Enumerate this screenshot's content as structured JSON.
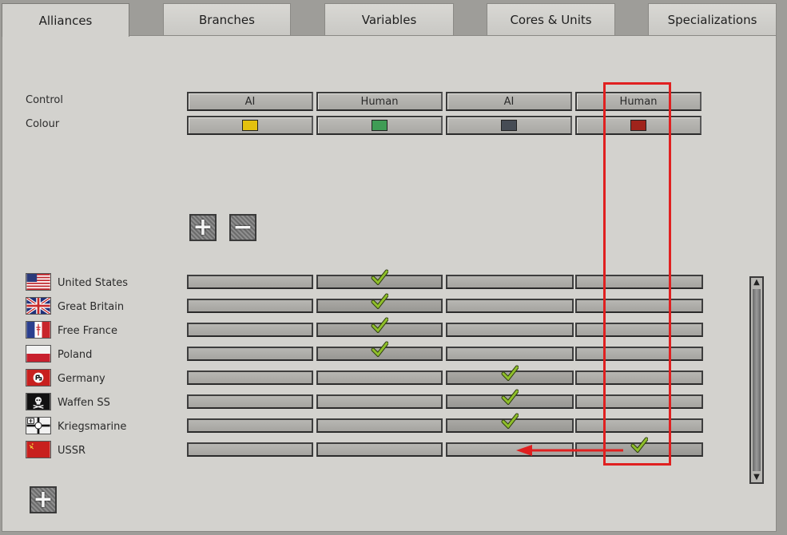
{
  "tabs": [
    {
      "label": "Alliances",
      "active": true
    },
    {
      "label": "Branches",
      "active": false
    },
    {
      "label": "Variables",
      "active": false
    },
    {
      "label": "Cores & Units",
      "active": false
    },
    {
      "label": "Specializations",
      "active": false
    }
  ],
  "settings": {
    "control_label": "Control",
    "colour_label": "Colour",
    "alliances": [
      {
        "control": "AI",
        "colour": "#e3c10f"
      },
      {
        "control": "Human",
        "colour": "#3f9c55"
      },
      {
        "control": "AI",
        "colour": "#464c55"
      },
      {
        "control": "Human",
        "colour": "#a0231b"
      }
    ]
  },
  "alliance_buttons": {
    "add": "+",
    "remove": "−"
  },
  "nations": [
    {
      "name": "United States",
      "flag": "usa-flag",
      "alliance": 2
    },
    {
      "name": "Great Britain",
      "flag": "gb-flag",
      "alliance": 2
    },
    {
      "name": "Free France",
      "flag": "free-france-flag",
      "alliance": 2
    },
    {
      "name": "Poland",
      "flag": "poland-flag",
      "alliance": 2
    },
    {
      "name": "Germany",
      "flag": "germany-flag",
      "alliance": 3
    },
    {
      "name": "Waffen SS",
      "flag": "waffen-ss-flag",
      "alliance": 3
    },
    {
      "name": "Kriegsmarine",
      "flag": "kriegsmarine-flag",
      "alliance": 3
    },
    {
      "name": "USSR",
      "flag": "ussr-flag",
      "alliance": 4
    }
  ],
  "add_nation_button": "+",
  "colors": {
    "highlight": "#e02020",
    "check": "#8fbf2a"
  }
}
